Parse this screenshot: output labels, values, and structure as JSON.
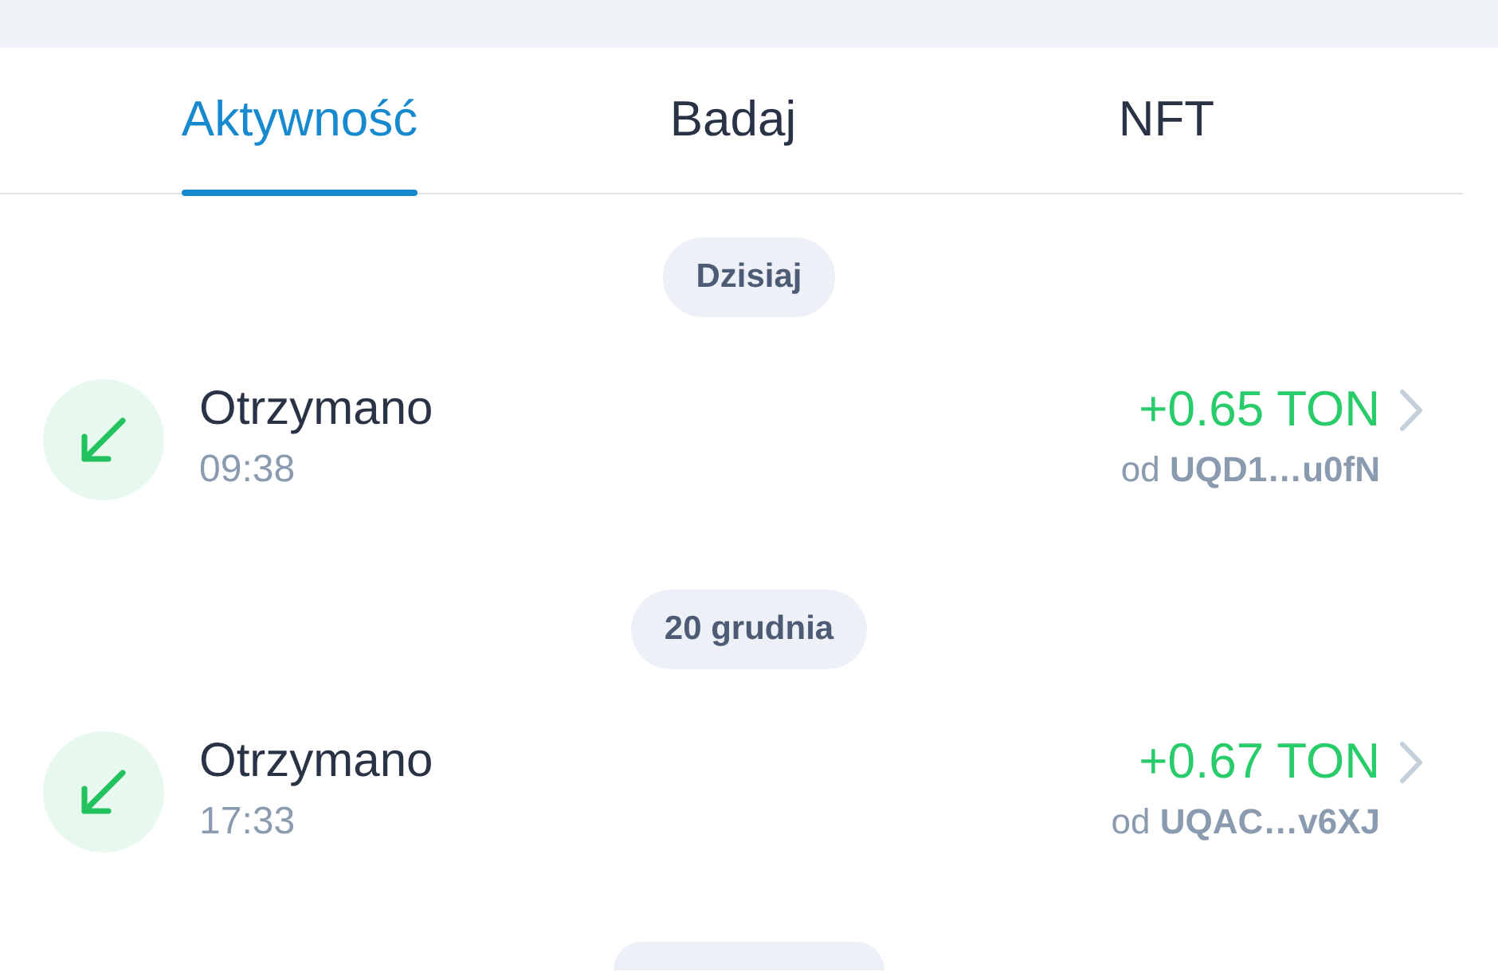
{
  "tabs": [
    {
      "label": "Aktywność",
      "selected": true
    },
    {
      "label": "Badaj",
      "selected": false
    },
    {
      "label": "NFT",
      "selected": false
    }
  ],
  "groups": [
    {
      "date": "Dzisiaj",
      "transactions": [
        {
          "kind": "received",
          "title": "Otrzymano",
          "time": "09:38",
          "amount": "+0.65 TON",
          "counterparty": "od **UQD1…u0fN**"
        }
      ]
    },
    {
      "date": "20 grudnia",
      "transactions": [
        {
          "kind": "received",
          "title": "Otrzymano",
          "time": "17:33",
          "amount": "+0.67 TON",
          "counterparty": "od **UQAC…v6XJ**"
        }
      ]
    }
  ],
  "cut_off_date_pill": true
}
